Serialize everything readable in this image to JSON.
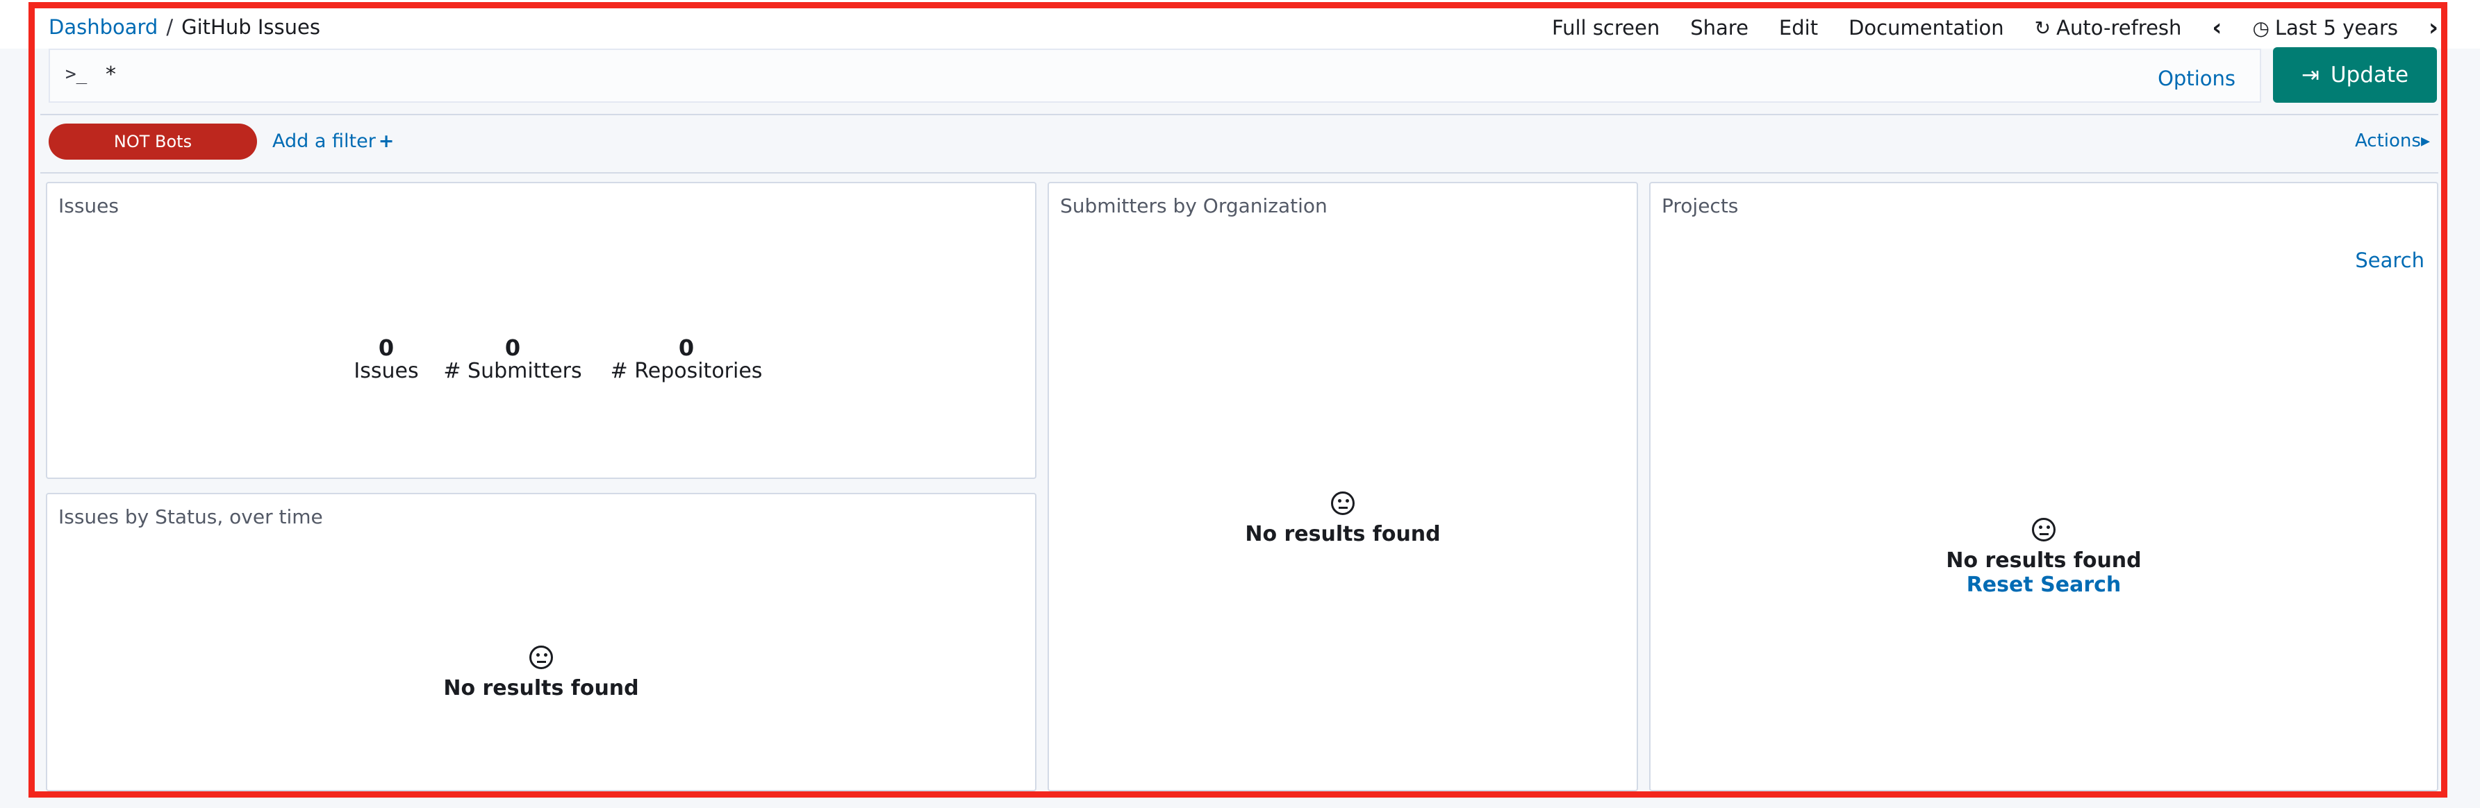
{
  "breadcrumb": {
    "root": "Dashboard",
    "separator": "/",
    "current": "GitHub Issues"
  },
  "top_menu": {
    "full_screen": "Full screen",
    "share": "Share",
    "edit": "Edit",
    "documentation": "Documentation",
    "auto_refresh": "Auto-refresh",
    "time_range": "Last 5 years"
  },
  "query": {
    "prompt": ">_",
    "value": "*",
    "options_label": "Options"
  },
  "update_button": {
    "label": "Update"
  },
  "filters": {
    "pill": "NOT Bots",
    "add_filter": "Add a filter",
    "actions": "Actions"
  },
  "panels": {
    "issues": {
      "title": "Issues",
      "metrics": [
        {
          "value": "0",
          "label": "Issues"
        },
        {
          "value": "0",
          "label": "# Submitters"
        },
        {
          "value": "0",
          "label": "# Repositories"
        }
      ]
    },
    "issues_by_status": {
      "title": "Issues by Status, over time",
      "empty": "No results found"
    },
    "submitters": {
      "title": "Submitters by Organization",
      "empty": "No results found"
    },
    "projects": {
      "title": "Projects",
      "search": "Search",
      "empty": "No results found",
      "reset": "Reset Search"
    }
  },
  "colors": {
    "accent": "#006bb4",
    "update": "#017d73",
    "filter_pill": "#bd271e",
    "frame": "#f3271d"
  }
}
